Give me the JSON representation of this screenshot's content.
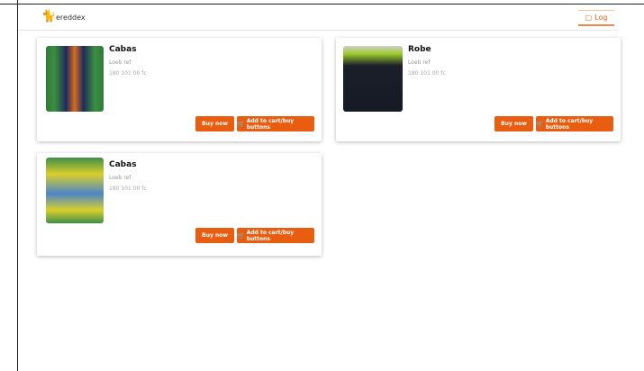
{
  "header": {
    "logo_text": "ereddex",
    "login_label": "Log"
  },
  "products": [
    {
      "name": "Cabas",
      "subtitle": "Loeb ref",
      "price": "180 101 00 fc",
      "buy_label": "Buy now",
      "cart_label": "Add to cart/buy buttons"
    },
    {
      "name": "Robe",
      "subtitle": "Loeb ref",
      "price": "180 101 00 fc",
      "buy_label": "Buy now",
      "cart_label": "Add to cart/buy buttons"
    },
    {
      "name": "Cabas",
      "subtitle": "Loeb ref",
      "price": "180 101 00 fc",
      "buy_label": "Buy now",
      "cart_label": "Add to cart/buy buttons"
    }
  ],
  "colors": {
    "accent": "#e85d10"
  },
  "icons": {
    "logo": "cat-logo-icon",
    "login": "login-icon",
    "cart": "cart-icon"
  }
}
